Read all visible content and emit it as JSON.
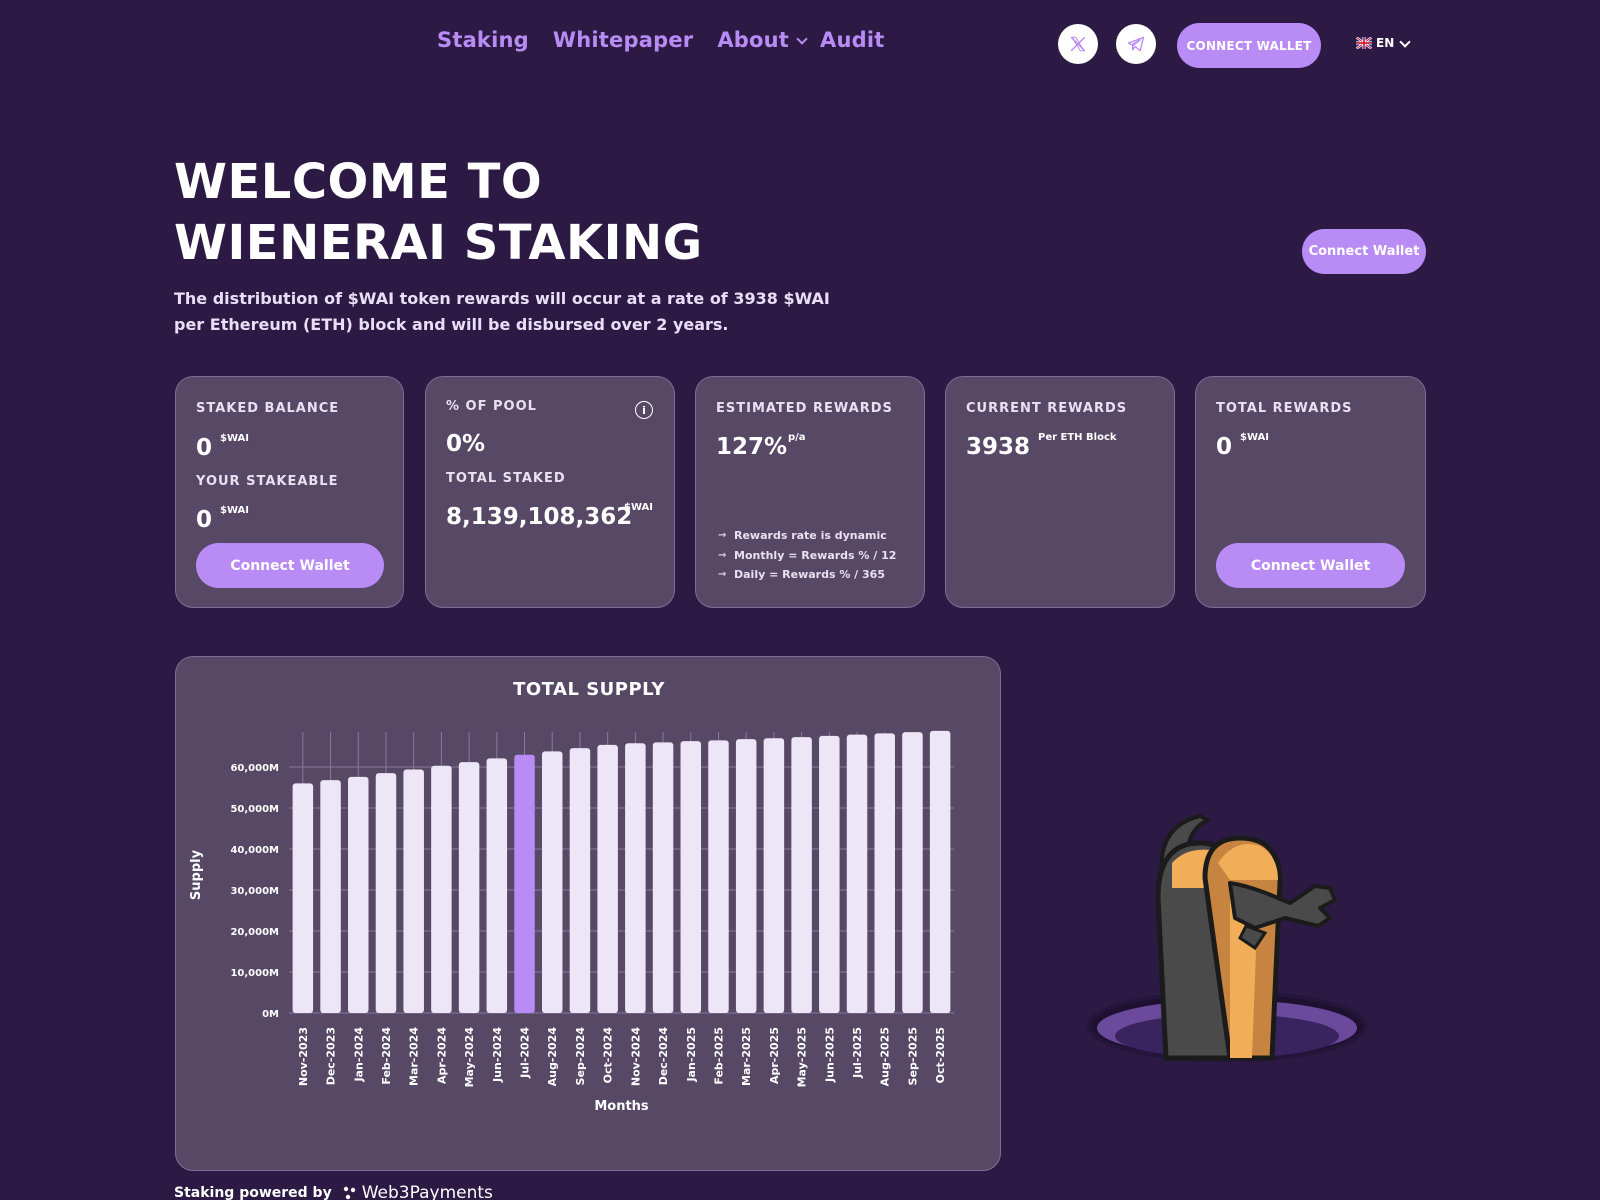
{
  "nav": {
    "links": [
      "Staking",
      "Whitepaper",
      "About",
      "Audit"
    ],
    "connect_label": "CONNECT WALLET",
    "language": "EN",
    "icons": {
      "x": "x-logo-icon",
      "telegram": "telegram-icon",
      "flag": "uk-flag-icon"
    }
  },
  "hero": {
    "title": "WELCOME TO WIENERAI STAKING",
    "description": "The distribution of $WAI token rewards will occur at a rate of 3938 $WAI per Ethereum (ETH) block and will be disbursed over 2 years.",
    "connect_label": "Connect Wallet"
  },
  "cards": {
    "staked": {
      "label": "STAKED BALANCE",
      "value": "0",
      "unit": "$WAI",
      "stakeable_label": "YOUR STAKEABLE",
      "stakeable_value": "0",
      "stakeable_unit": "$WAI",
      "button": "Connect Wallet"
    },
    "pool": {
      "label": "% OF POOL",
      "value": "0%",
      "total_label": "TOTAL STAKED",
      "total_value": "8,139,108,362",
      "total_unit": "$WAI"
    },
    "estimated": {
      "label": "ESTIMATED REWARDS",
      "value": "127%",
      "unit": "p/a",
      "notes": [
        "Rewards rate is dynamic",
        "Monthly = Rewards % / 12",
        "Daily = Rewards % / 365"
      ]
    },
    "current": {
      "label": "CURRENT REWARDS",
      "value": "3938",
      "unit": "Per ETH Block"
    },
    "total": {
      "label": "TOTAL REWARDS",
      "value": "0",
      "unit": "$WAI",
      "button": "Connect Wallet"
    }
  },
  "chart_data": {
    "type": "bar",
    "title": "TOTAL SUPPLY",
    "xlabel": "Months",
    "ylabel": "Supply",
    "ylim": [
      0,
      60000
    ],
    "yticks": [
      "0M",
      "10,000M",
      "20,000M",
      "30,000M",
      "40,000M",
      "50,000M",
      "60,000M"
    ],
    "categories": [
      "Nov-2023",
      "Dec-2023",
      "Jan-2024",
      "Feb-2024",
      "Mar-2024",
      "Apr-2024",
      "May-2024",
      "Jun-2024",
      "Jul-2024",
      "Aug-2024",
      "Sep-2024",
      "Oct-2024",
      "Nov-2024",
      "Dec-2024",
      "Jan-2025",
      "Feb-2025",
      "Mar-2025",
      "Apr-2025",
      "May-2025",
      "Jun-2025",
      "Jul-2025",
      "Aug-2025",
      "Sep-2025",
      "Oct-2025"
    ],
    "values": [
      56000,
      56800,
      57600,
      58500,
      59400,
      60300,
      61200,
      62100,
      63000,
      63800,
      64600,
      65400,
      65800,
      66000,
      66300,
      66500,
      66800,
      67000,
      67300,
      67600,
      67900,
      68200,
      68500,
      68800
    ],
    "highlight_index": 8,
    "colors": {
      "bar": "#ece6f7",
      "highlight": "#b98cf5"
    },
    "grid": true
  },
  "footer": {
    "text": "Staking powered by",
    "brand": "Web3Payments"
  }
}
